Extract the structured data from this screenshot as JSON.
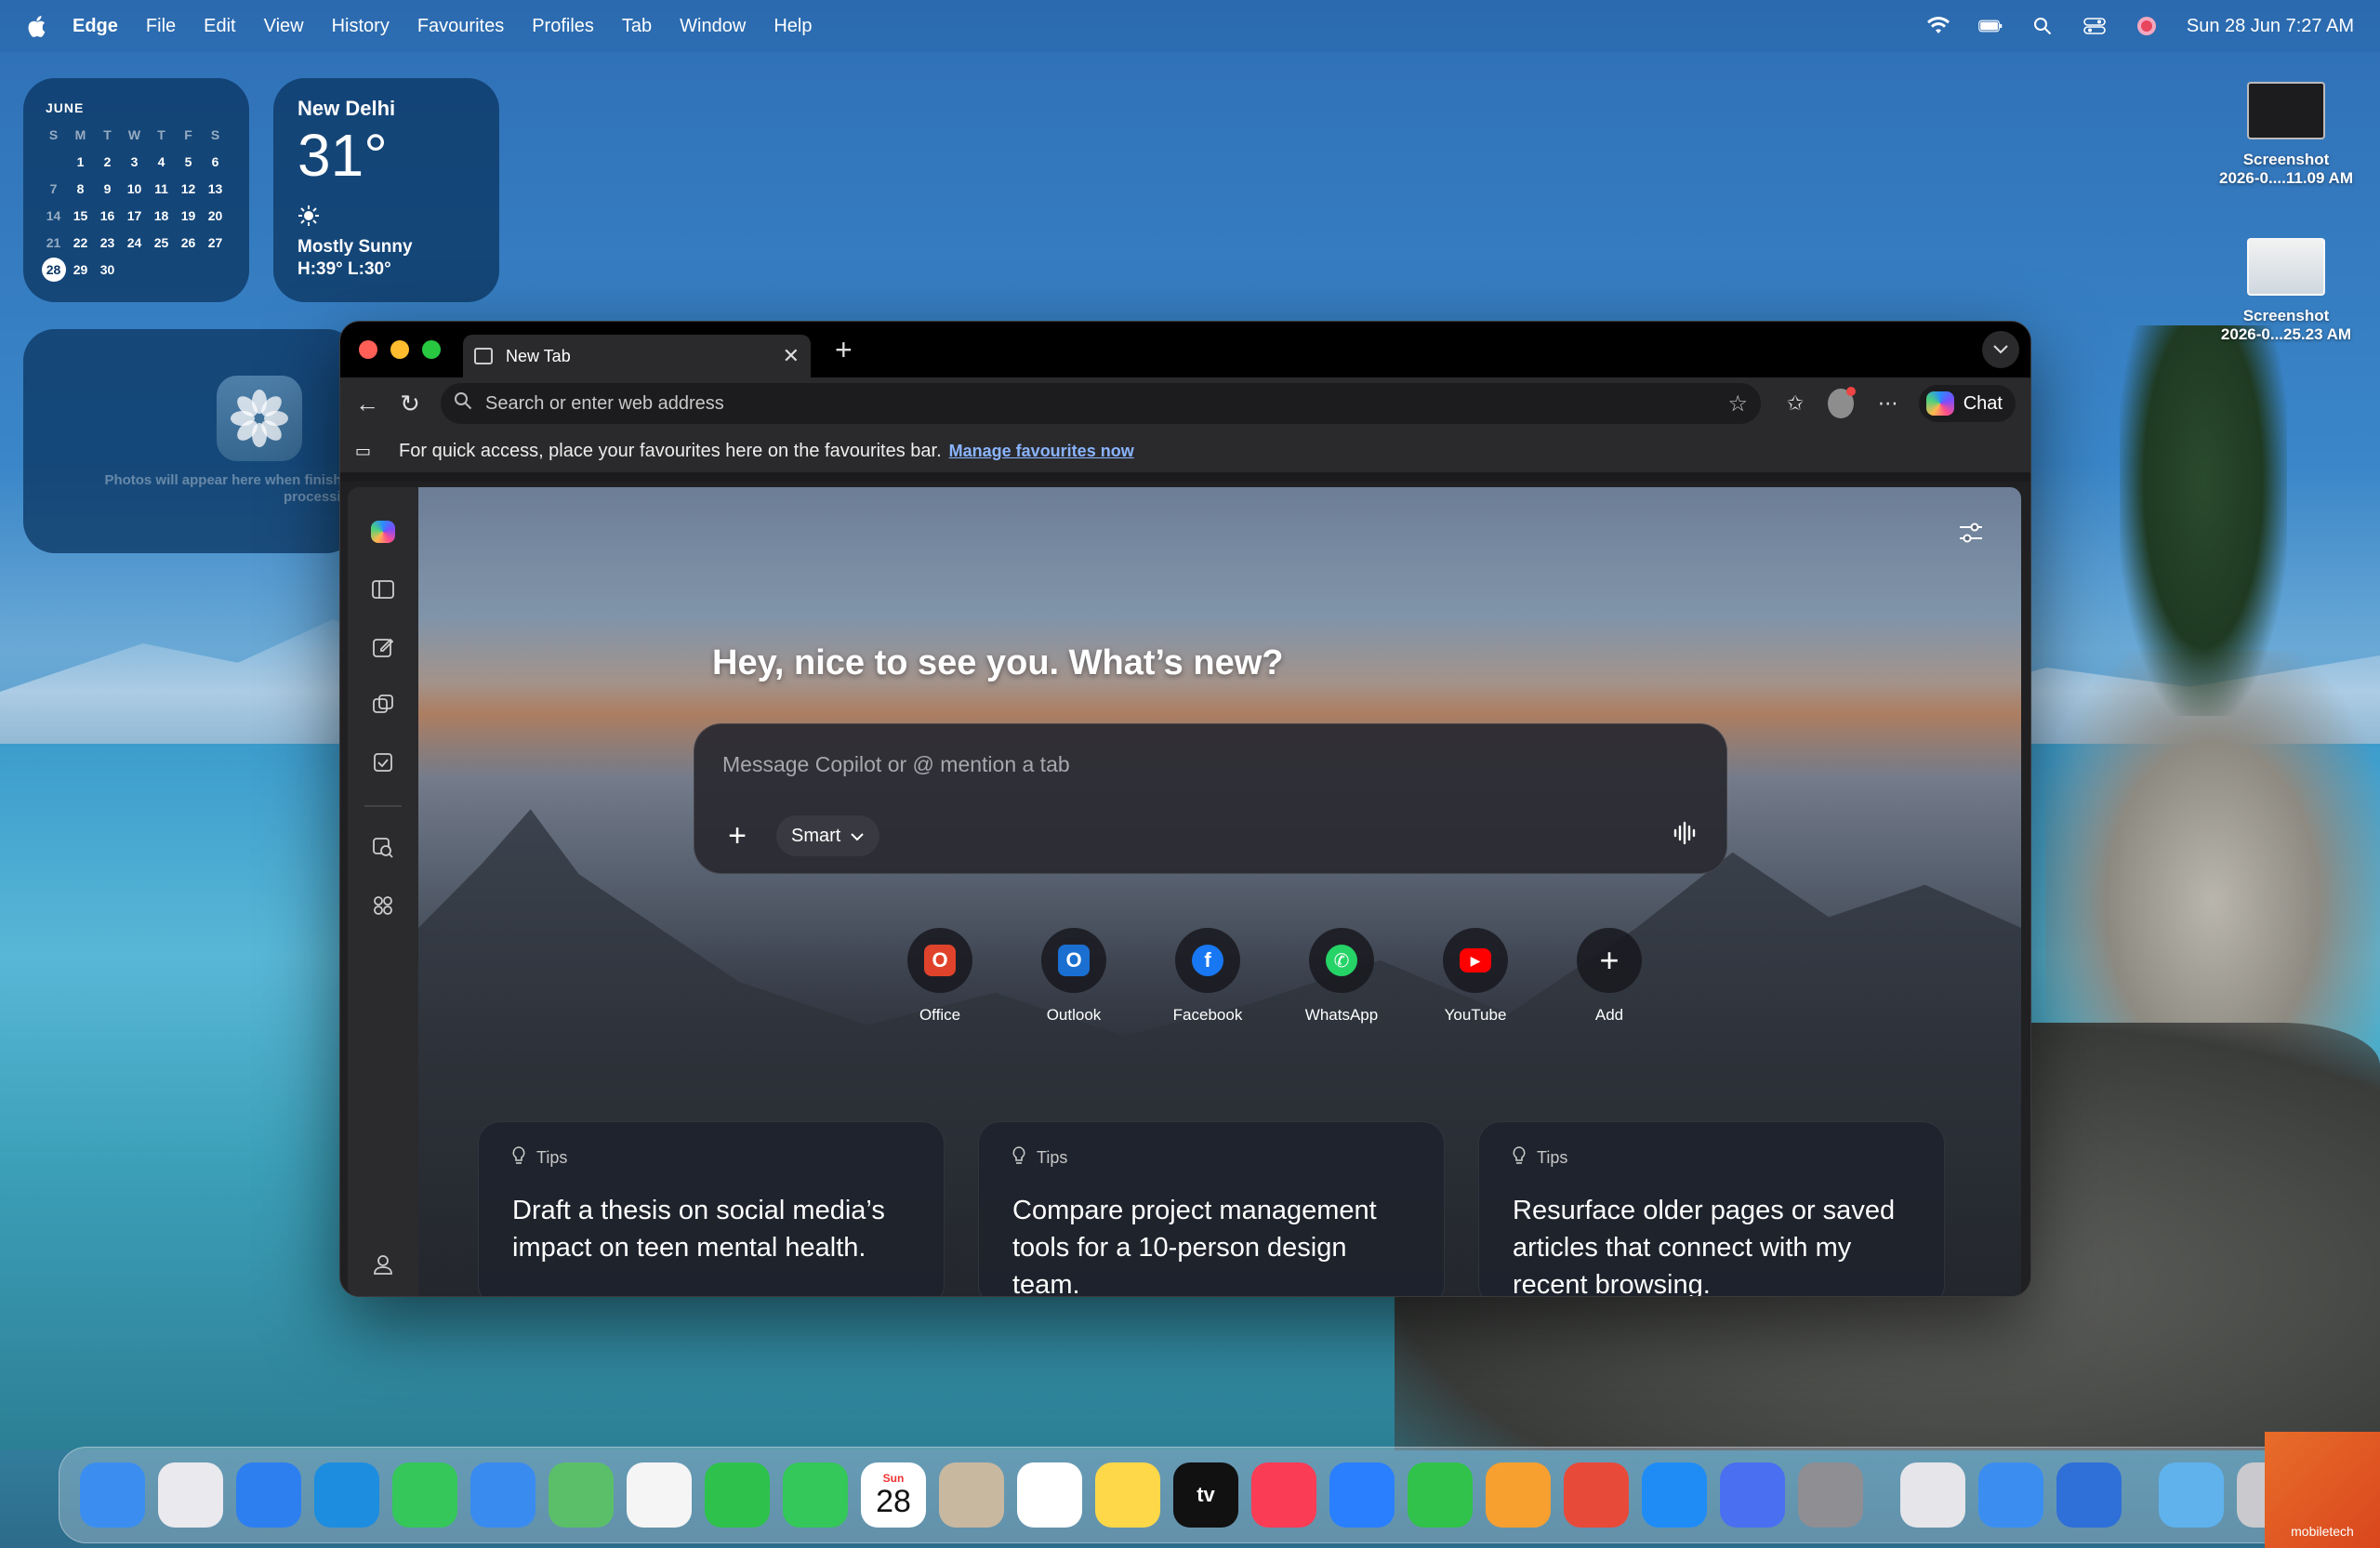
{
  "menubar": {
    "app_name": "Edge",
    "items": [
      "File",
      "Edit",
      "View",
      "History",
      "Favourites",
      "Profiles",
      "Tab",
      "Window",
      "Help"
    ],
    "datetime": "Sun 28 Jun  7:27 AM"
  },
  "calendar": {
    "month": "JUNE",
    "weekdays": [
      "S",
      "M",
      "T",
      "W",
      "T",
      "F",
      "S"
    ],
    "weeks": [
      [
        "",
        "1",
        "2",
        "3",
        "4",
        "5",
        "6"
      ],
      [
        "7",
        "8",
        "9",
        "10",
        "11",
        "12",
        "13"
      ],
      [
        "14",
        "15",
        "16",
        "17",
        "18",
        "19",
        "20"
      ],
      [
        "21",
        "22",
        "23",
        "24",
        "25",
        "26",
        "27"
      ],
      [
        "28",
        "29",
        "30",
        "",
        "",
        "",
        ""
      ]
    ],
    "today": "28"
  },
  "weather": {
    "city": "New Delhi",
    "temp": "31°",
    "condition": "Mostly Sunny",
    "high_low": "H:39° L:30°"
  },
  "photos_widget": {
    "message": "Photos will appear here when finished processing"
  },
  "desktop_files": [
    {
      "name_line1": "Screenshot",
      "name_line2": "2026-0....11.09 AM"
    },
    {
      "name_line1": "Screenshot",
      "name_line2": "2026-0...25.23 AM"
    }
  ],
  "browser": {
    "tab_title": "New Tab",
    "address_placeholder": "Search or enter web address",
    "chat_label": "Chat",
    "favbar_text": "For quick access, place your favourites here on the favourites bar.",
    "favbar_link": "Manage favourites now",
    "greeting": "Hey, nice to see you. What’s new?",
    "composer_placeholder": "Message Copilot or @ mention a tab",
    "smart_label": "Smart",
    "quick_links": [
      {
        "label": "Office",
        "color": "#e0432b",
        "glyph": "O"
      },
      {
        "label": "Outlook",
        "color": "#1b6fd1",
        "glyph": "O"
      },
      {
        "label": "Facebook",
        "color": "#1877f2",
        "glyph": "f"
      },
      {
        "label": "WhatsApp",
        "color": "#25d366",
        "glyph": "✆"
      },
      {
        "label": "YouTube",
        "color": "#ff0000",
        "glyph": "▶"
      },
      {
        "label": "Add",
        "color": "",
        "glyph": "+"
      }
    ],
    "tips": [
      {
        "head": "Tips",
        "text": "Draft a thesis on social media’s impact on teen mental health."
      },
      {
        "head": "Tips",
        "text": "Compare project management tools for a 10-person design team."
      },
      {
        "head": "Tips",
        "text": "Resurface older pages or saved articles that connect with my recent browsing."
      }
    ]
  },
  "dock": {
    "apps": [
      {
        "name": "finder",
        "color": "#3b8ef0"
      },
      {
        "name": "launchpad",
        "color": "#e9e9ee"
      },
      {
        "name": "safari",
        "color": "#2d7ff0"
      },
      {
        "name": "edge",
        "color": "#1d8de0"
      },
      {
        "name": "messages",
        "color": "#35c759"
      },
      {
        "name": "mail",
        "color": "#3a8bf0"
      },
      {
        "name": "maps",
        "color": "#5bbf6a"
      },
      {
        "name": "photos",
        "color": "#f5f5f5"
      },
      {
        "name": "facetime",
        "color": "#2ec24d"
      },
      {
        "name": "phone",
        "color": "#34c759"
      },
      {
        "name": "calendar",
        "color": "#ffffff",
        "day": "Sun",
        "date": "28"
      },
      {
        "name": "contacts",
        "color": "#c8b8a0"
      },
      {
        "name": "reminders",
        "color": "#ffffff"
      },
      {
        "name": "notes",
        "color": "#ffd84a"
      },
      {
        "name": "apple-tv",
        "color": "#111111",
        "text": "tv"
      },
      {
        "name": "music",
        "color": "#fa3c55"
      },
      {
        "name": "keynote",
        "color": "#2a7fff"
      },
      {
        "name": "numbers",
        "color": "#31c24b"
      },
      {
        "name": "pages",
        "color": "#f7a030"
      },
      {
        "name": "rocket",
        "color": "#e84a3a"
      },
      {
        "name": "app-store",
        "color": "#1f8cf5"
      },
      {
        "name": "simulator",
        "color": "#4a6ff0"
      },
      {
        "name": "system-settings",
        "color": "#8e8e93"
      },
      {
        "name": "preview",
        "color": "#e5e5ea"
      },
      {
        "name": "weather",
        "color": "#3b8ef0"
      },
      {
        "name": "migration",
        "color": "#2f6fd8"
      },
      {
        "name": "downloads-folder",
        "color": "#5fb2ec"
      },
      {
        "name": "trash",
        "color": "#c9c9ce"
      }
    ],
    "corner_badge": "mobiletech"
  }
}
